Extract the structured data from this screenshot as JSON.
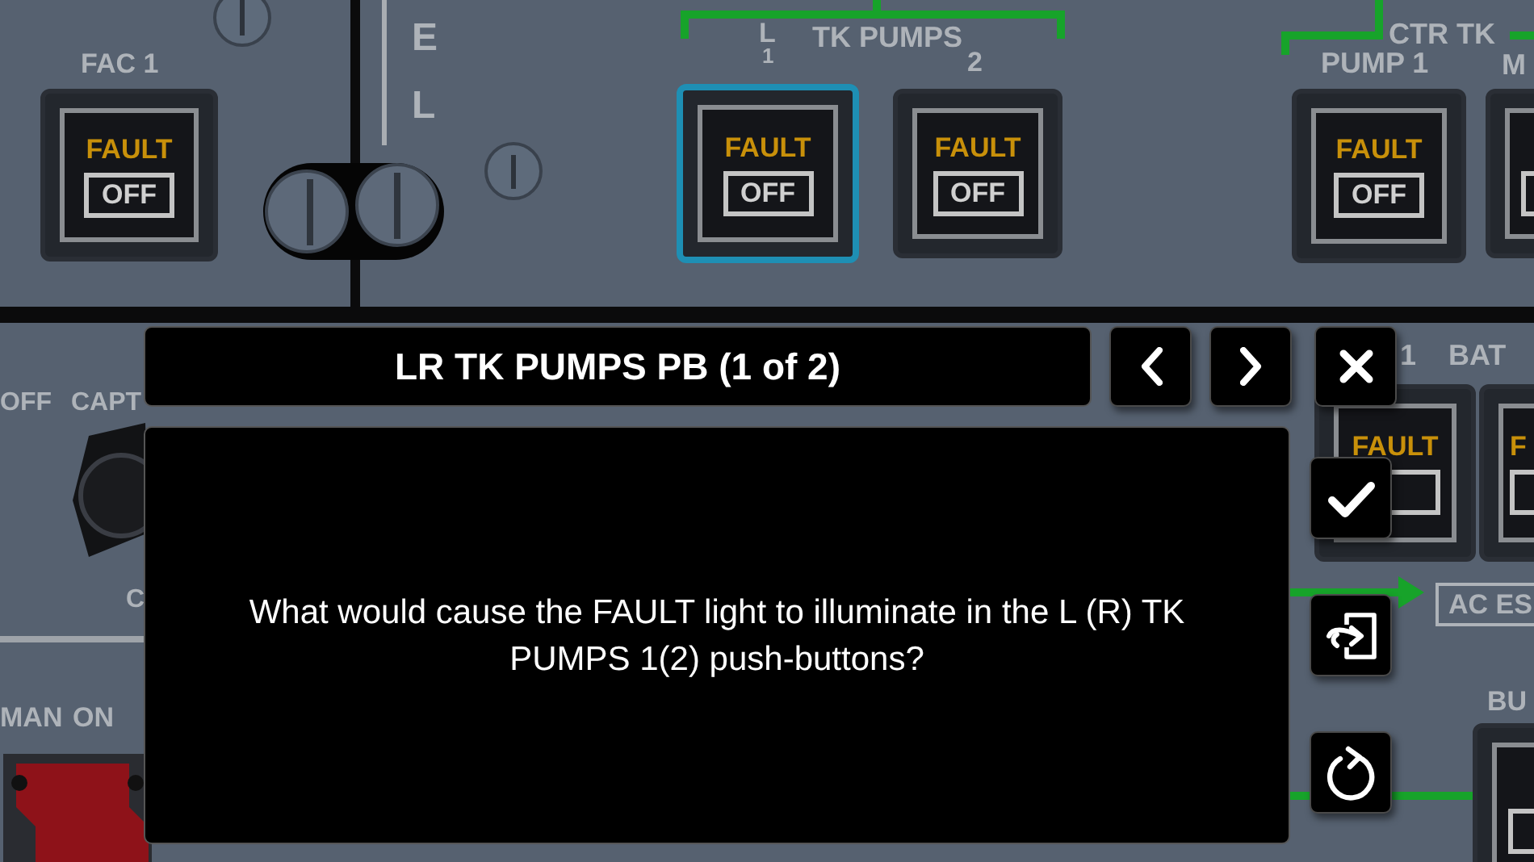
{
  "panel": {
    "labels": [
      {
        "text": "FAC 1"
      },
      {
        "text": "E"
      },
      {
        "text": "L"
      },
      {
        "text": "L"
      },
      {
        "text": "1"
      },
      {
        "text": "TK PUMPS"
      },
      {
        "text": "2"
      },
      {
        "text": "CTR TK"
      },
      {
        "text": "PUMP 1"
      },
      {
        "text": "M"
      },
      {
        "text": "OFF"
      },
      {
        "text": "CAPT"
      },
      {
        "text": "C"
      },
      {
        "text": "MAN"
      },
      {
        "text": "ON"
      },
      {
        "text": "1"
      },
      {
        "text": "BAT"
      },
      {
        "text": "AC ES"
      },
      {
        "text": "BU"
      }
    ],
    "push_buttons": [
      {
        "fault": "FAULT",
        "off": "OFF",
        "selected": false
      },
      {
        "fault": "FAULT",
        "off": "OFF",
        "selected": true
      },
      {
        "fault": "FAULT",
        "off": "OFF",
        "selected": false
      },
      {
        "fault": "FAULT",
        "off": "OFF",
        "selected": false
      },
      {
        "selected": false
      },
      {
        "fault": "FAULT",
        "selected": false
      },
      {
        "fault": "F",
        "selected": false
      },
      {
        "selected": false
      }
    ]
  },
  "dialog": {
    "title": "LR TK PUMPS PB (1 of 2)",
    "question": "What would cause the FAULT light to illuminate in the L (R) TK PUMPS 1(2) push-buttons?",
    "nav_buttons": [
      {
        "kind": "previous"
      },
      {
        "kind": "next"
      },
      {
        "kind": "close"
      }
    ],
    "side_buttons": [
      {
        "kind": "check"
      },
      {
        "kind": "exit"
      },
      {
        "kind": "reset"
      }
    ]
  }
}
